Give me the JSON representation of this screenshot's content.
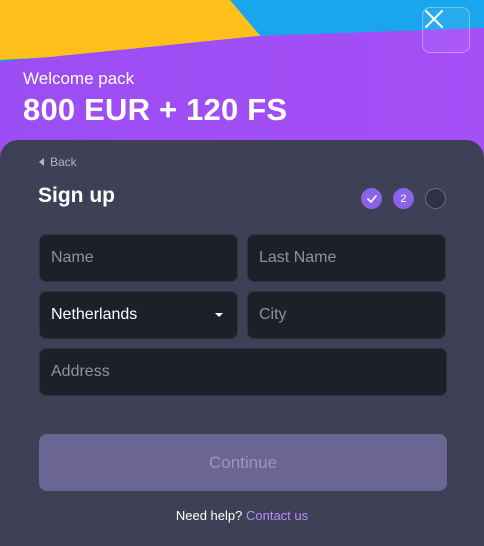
{
  "promo": {
    "label": "Welcome pack",
    "amount": "800 EUR + 120 FS"
  },
  "form": {
    "back_label": "Back",
    "title": "Sign up",
    "steps": [
      {
        "state": "done",
        "label": "✓"
      },
      {
        "state": "current",
        "label": "2"
      },
      {
        "state": "todo",
        "label": ""
      }
    ],
    "fields": {
      "name_placeholder": "Name",
      "last_name_placeholder": "Last Name",
      "country_value": "Netherlands",
      "city_placeholder": "City",
      "address_placeholder": "Address"
    },
    "continue_label": "Continue",
    "help_text": "Need help?",
    "contact_label": "Contact us"
  },
  "colors": {
    "accent": "#8a63e6",
    "panel": "#3e4156",
    "input_bg": "#1e2029",
    "link": "#b58cff"
  },
  "icons": {
    "close": "close-icon",
    "back": "chevron-left-icon",
    "dropdown": "caret-down-icon",
    "check": "check-icon"
  }
}
